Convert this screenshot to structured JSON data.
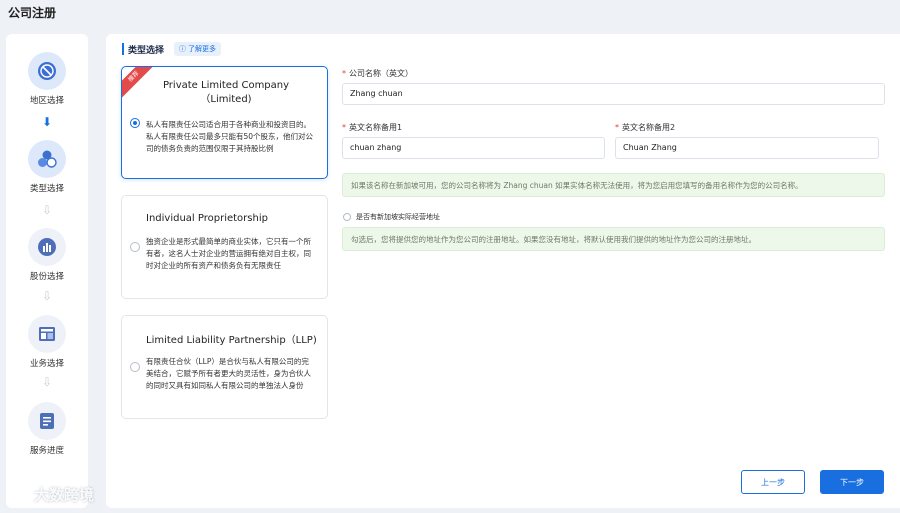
{
  "page": {
    "title": "公司注册"
  },
  "steps": [
    {
      "label": "地区选择",
      "icon": "globe-icon",
      "state": "active"
    },
    {
      "label": "类型选择",
      "icon": "cluster-icon",
      "state": "active"
    },
    {
      "label": "股份选择",
      "icon": "bar-chart-icon",
      "state": "inactive"
    },
    {
      "label": "业务选择",
      "icon": "layout-icon",
      "state": "inactive"
    },
    {
      "label": "服务进度",
      "icon": "document-icon",
      "state": "inactive"
    }
  ],
  "section": {
    "title": "类型选择",
    "learn_more": "了解更多"
  },
  "types": [
    {
      "title": "Private Limited Company （Limited)",
      "badge": "推荐",
      "desc": "私人有限责任公司适合用于各种商业和投资目的。私人有限责任公司最多只能有50个股东，他们对公司的债务负责的范围仅限于其持股比例",
      "selected": true
    },
    {
      "title": "Individual Proprietorship",
      "desc": "独资企业是形式最简单的商业实体，它只有一个所有者，这名人士对企业的营运拥有绝对自主权，同时对企业的所有资产和债务负有无限责任",
      "selected": false
    },
    {
      "title": "Limited Liability Partnership（LLP)",
      "desc": "有限责任合伙（LLP）是合伙与私人有限公司的完美结合，它赋予所有者更大的灵活性，身为合伙人的同时又具有如同私人有限公司的单独法人身份",
      "selected": false
    }
  ],
  "form": {
    "company_name_label": "公司名称（英文）",
    "company_name_value": "Zhang chuan",
    "alt_name1_label": "英文名称备用1",
    "alt_name1_value": "chuan zhang",
    "alt_name2_label": "英文名称备用2",
    "alt_name2_value": "Chuan Zhang",
    "name_notice": "如果该名称在新加坡可用，您的公司名称将为 Zhang chuan 如果实体名称无法使用，将为您启用您填写的备用名称作为您的公司名称。",
    "address_checkbox_label": "是否有新加坡实际经营地址",
    "address_notice": "勾选后，您将提供您的地址作为您公司的注册地址。如果您没有地址，将默认使用我们提供的地址作为您公司的注册地址。"
  },
  "buttons": {
    "prev": "上一步",
    "next": "下一步"
  },
  "watermark": {
    "text": "大数跨境"
  },
  "colors": {
    "accent": "#1a6fe0",
    "badge": "#e34b4b",
    "notice_bg": "#eef8ea"
  }
}
